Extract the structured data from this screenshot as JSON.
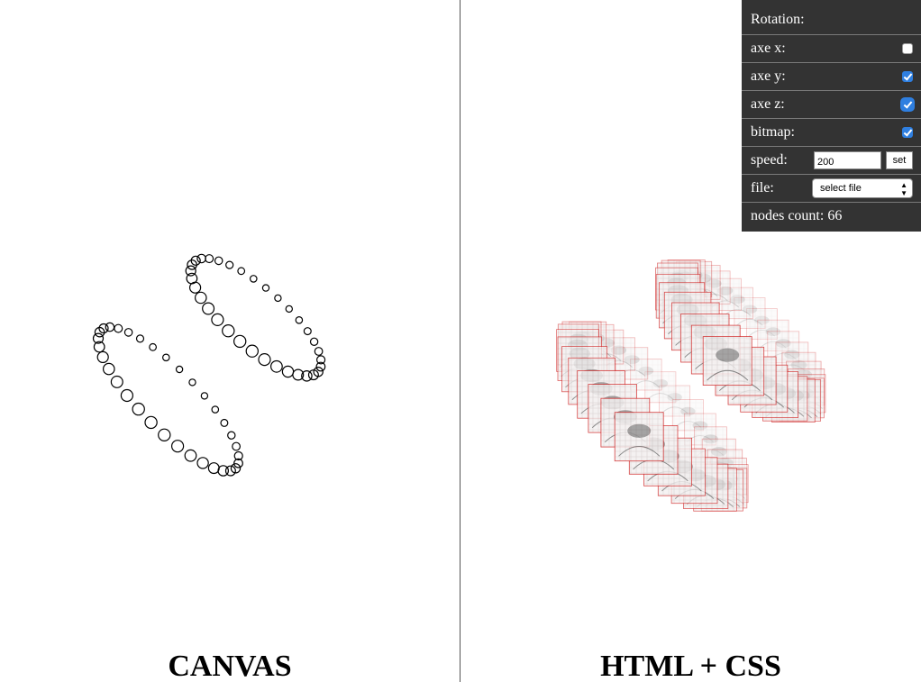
{
  "left_pane": {
    "label": "CANVAS"
  },
  "right_pane": {
    "label": "HTML + CSS"
  },
  "controls": {
    "title": "Rotation:",
    "axe_x": {
      "label": "axe x:",
      "checked": false
    },
    "axe_y": {
      "label": "axe y:",
      "checked": true
    },
    "axe_z": {
      "label": "axe z:",
      "checked": true
    },
    "bitmap": {
      "label": "bitmap:",
      "checked": true
    },
    "speed": {
      "label": "speed:",
      "value": "200",
      "button": "set"
    },
    "file": {
      "label": "file:",
      "selected": "select file"
    },
    "nodes": {
      "label": "nodes count: 66"
    }
  },
  "colors": {
    "panel_bg": "#333333",
    "checkbox_on": "#2f7fe0",
    "node_outline": "#d02020",
    "circle_stroke": "#000000"
  }
}
